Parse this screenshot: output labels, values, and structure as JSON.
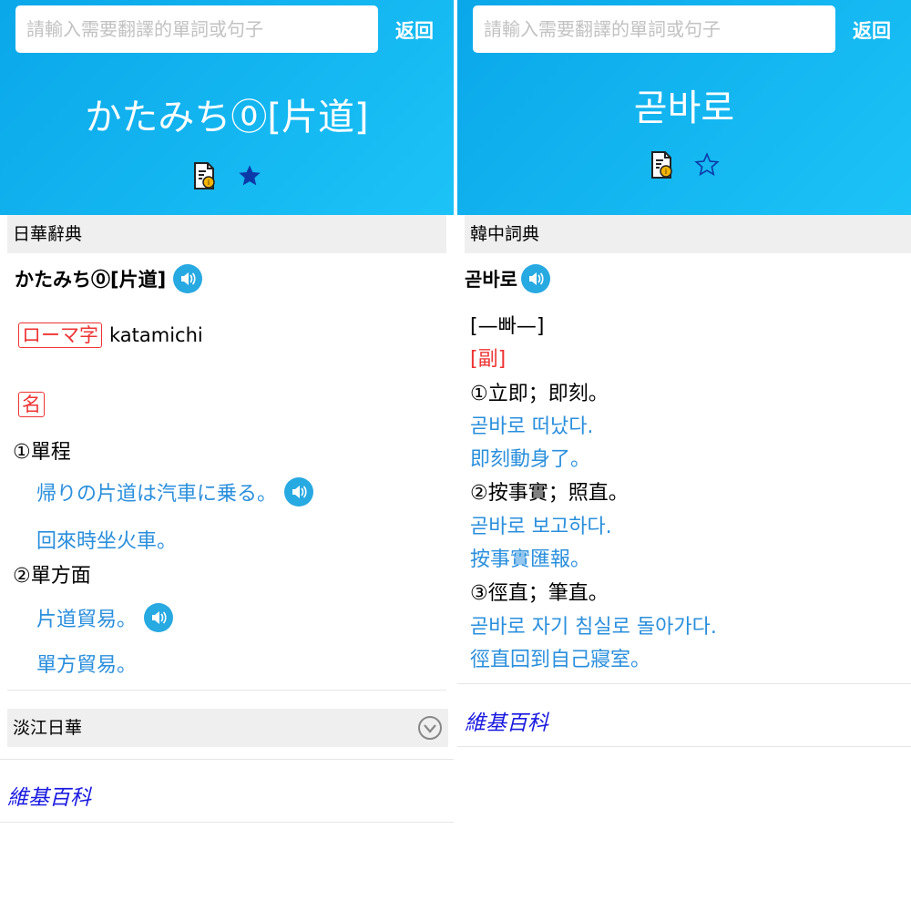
{
  "left": {
    "search_placeholder": "請輸入需要翻譯的單詞或句子",
    "back_label": "返回",
    "headword": "かたみち⓪[片道]",
    "section1_title": "日華辭典",
    "entry_title": "かたみち⓪[片道]",
    "romaji_tag": "ローマ字",
    "romaji_value": "katamichi",
    "pos_tag": "名",
    "sense1_label": "①單程",
    "sense1_example_jp": "帰りの片道は汽車に乗る。",
    "sense1_example_zh": "回來時坐火車。",
    "sense2_label": "②單方面",
    "sense2_example_jp": "片道貿易。",
    "sense2_example_zh": "單方貿易。",
    "section2_title": "淡江日華",
    "wiki_label": "維基百科",
    "star_filled": true
  },
  "right": {
    "search_placeholder": "請輸入需要翻譯的單詞或句子",
    "back_label": "返回",
    "headword": "곧바로",
    "section1_title": "韓中詞典",
    "entry_title": "곧바로",
    "pronunciation": "[—빠—]",
    "pos_tag": "[副]",
    "senses": [
      {
        "label": "①立即；即刻。",
        "example_ko": "곧바로 떠났다.",
        "example_zh": "即刻動身了。"
      },
      {
        "label": "②按事實；照直。",
        "example_ko": "곧바로 보고하다.",
        "example_zh": "按事實匯報。"
      },
      {
        "label": "③徑直；筆直。",
        "example_ko": "곧바로 자기 침실로 돌아가다.",
        "example_zh": "徑直回到自己寢室。"
      }
    ],
    "wiki_label": "維基百科",
    "star_filled": false
  },
  "colors": {
    "header_gradient_start": "#0aa7e9",
    "header_gradient_end": "#1cc3f7",
    "example_blue": "#2a8fdc",
    "tag_red": "#ee3333",
    "wiki_link": "#1a1ae0",
    "star_filled": "#0b3aa8"
  },
  "icons": {
    "note": "document-translate-icon",
    "favorite": "star-icon",
    "audio": "speaker-icon",
    "expand": "chevron-down-circle-icon"
  }
}
